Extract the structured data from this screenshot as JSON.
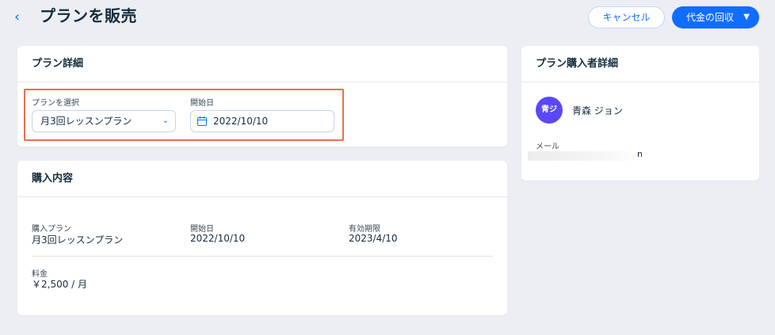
{
  "header": {
    "back_icon": "chevron-left-icon",
    "title": "プランを販売",
    "cancel_label": "キャンセル",
    "collect_label": "代金の回収",
    "collect_icon": "chevron-down-icon"
  },
  "plan_details": {
    "title": "プラン詳細",
    "plan_select_label": "プランを選択",
    "plan_select_value": "月3回レッスンプラン",
    "start_date_label": "開始日",
    "start_date_value": "2022/10/10"
  },
  "purchase": {
    "title": "購入内容",
    "plan_label": "購入プラン",
    "plan_value": "月3回レッスンプラン",
    "start_label": "開始日",
    "start_value": "2022/10/10",
    "expiry_label": "有効期限",
    "expiry_value": "2023/4/10",
    "fee_label": "料金",
    "fee_value": "￥2,500 / 月"
  },
  "buyer": {
    "title": "プラン購入者詳細",
    "avatar_initials": "青ジ",
    "name": "青森 ジョン",
    "email_label": "メール",
    "email_tail": "n"
  },
  "colors": {
    "accent": "#116dff",
    "highlight": "#e8704e",
    "avatar": "#5a48f5",
    "background": "#eceef3"
  }
}
